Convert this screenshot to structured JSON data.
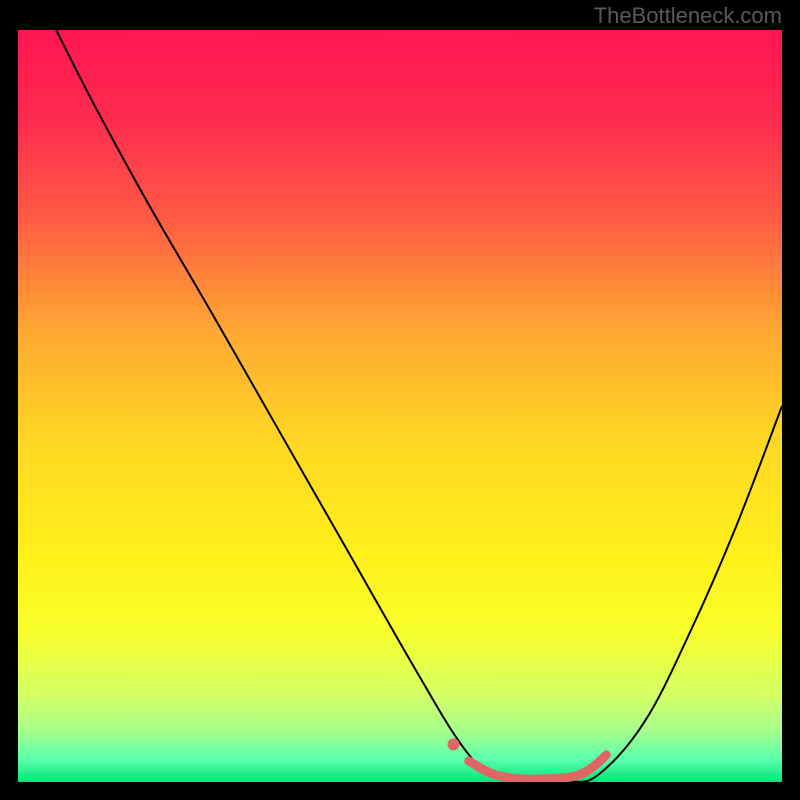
{
  "attribution": "TheBottleneck.com",
  "chart_data": {
    "type": "line",
    "title": "",
    "xlabel": "",
    "ylabel": "",
    "xlim": [
      0,
      100
    ],
    "ylim": [
      0,
      100
    ],
    "background_gradient": {
      "stops": [
        {
          "offset": 0,
          "color": "#ff1552"
        },
        {
          "offset": 12,
          "color": "#ff2b4f"
        },
        {
          "offset": 25,
          "color": "#ff5b44"
        },
        {
          "offset": 40,
          "color": "#ffa832"
        },
        {
          "offset": 55,
          "color": "#ffd823"
        },
        {
          "offset": 70,
          "color": "#fff01a"
        },
        {
          "offset": 80,
          "color": "#f8ff2a"
        },
        {
          "offset": 88,
          "color": "#d7ff62"
        },
        {
          "offset": 93,
          "color": "#a8ff8a"
        },
        {
          "offset": 97,
          "color": "#5bffad"
        },
        {
          "offset": 100,
          "color": "#00e676"
        }
      ]
    },
    "series": [
      {
        "name": "bottleneck-curve",
        "type": "line",
        "color": "#000000",
        "width": 2,
        "x": [
          5,
          10,
          17,
          25,
          34,
          43,
          52,
          58,
          62,
          67,
          72,
          76,
          82,
          88,
          94,
          100
        ],
        "y": [
          100,
          90,
          77,
          63,
          47,
          31,
          15,
          5,
          1,
          0,
          0,
          1,
          8,
          20,
          34,
          50
        ]
      },
      {
        "name": "highlight-segment",
        "type": "line",
        "color": "#e06666",
        "width": 9,
        "cap": "round",
        "x": [
          59,
          60,
          61,
          63,
          66,
          69,
          72,
          74,
          75.5,
          77
        ],
        "y": [
          2.8,
          2.2,
          1.6,
          0.8,
          0.4,
          0.4,
          0.6,
          1.2,
          2.2,
          3.6
        ]
      },
      {
        "name": "highlight-dot",
        "type": "scatter",
        "color": "#e06666",
        "radius": 6,
        "x": [
          57
        ],
        "y": [
          5
        ]
      }
    ]
  }
}
